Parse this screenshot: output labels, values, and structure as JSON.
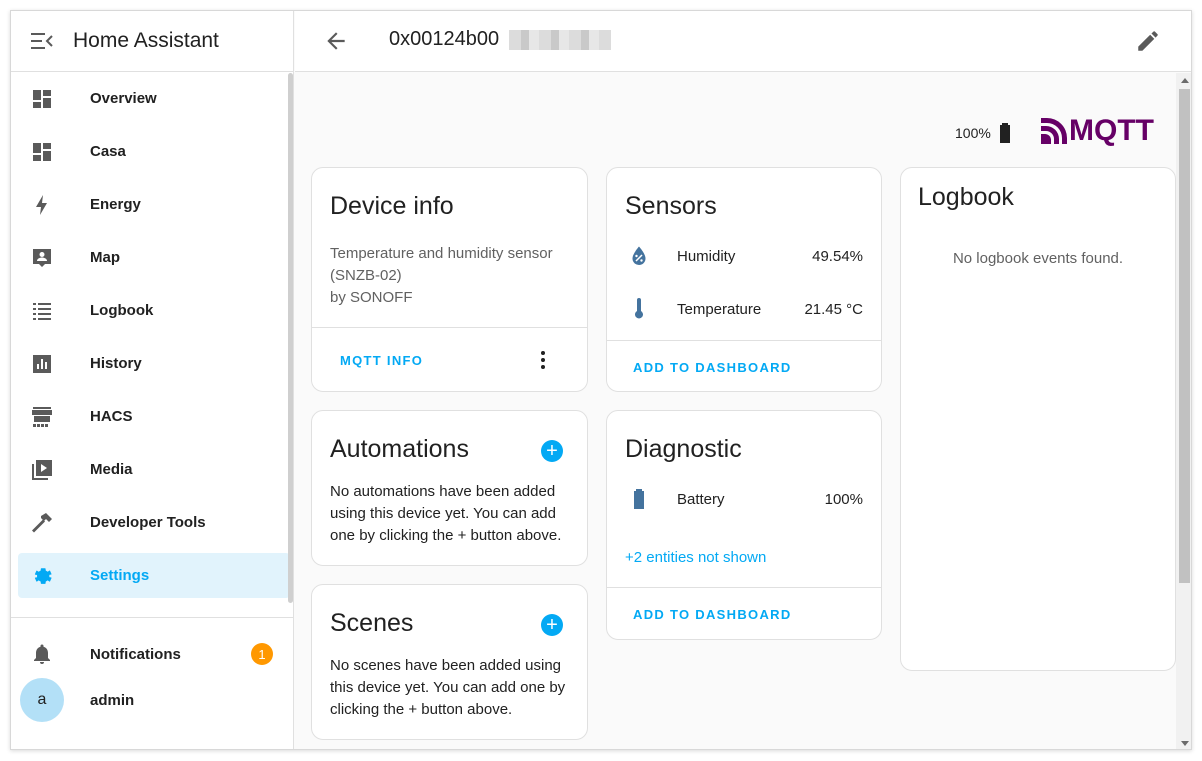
{
  "sidebar": {
    "title": "Home Assistant",
    "items": [
      {
        "label": "Overview",
        "icon": "overview-icon"
      },
      {
        "label": "Casa",
        "icon": "dashboard-icon"
      },
      {
        "label": "Energy",
        "icon": "lightning-icon"
      },
      {
        "label": "Map",
        "icon": "map-icon"
      },
      {
        "label": "Logbook",
        "icon": "logbook-icon"
      },
      {
        "label": "History",
        "icon": "history-chart-icon"
      },
      {
        "label": "HACS",
        "icon": "hacs-store-icon"
      },
      {
        "label": "Media",
        "icon": "media-icon"
      },
      {
        "label": "Developer Tools",
        "icon": "hammer-icon"
      },
      {
        "label": "Settings",
        "icon": "gear-icon"
      }
    ],
    "notifications": {
      "label": "Notifications",
      "count": "1"
    },
    "user": {
      "label": "admin",
      "initial": "a"
    }
  },
  "topbar": {
    "title": "0x00124b00"
  },
  "header_info": {
    "battery": "100%",
    "integration": "MQTT"
  },
  "device_info": {
    "title": "Device info",
    "model": "Temperature and humidity sensor",
    "model_id": "(SNZB-02)",
    "manufacturer": "by SONOFF",
    "action": "MQTT INFO"
  },
  "automations": {
    "title": "Automations",
    "text": "No automations have been added using this device yet. You can add one by clicking the + button above."
  },
  "scenes": {
    "title": "Scenes",
    "text": "No scenes have been added using this device yet. You can add one by clicking the + button above."
  },
  "sensors": {
    "title": "Sensors",
    "entities": [
      {
        "name": "Humidity",
        "value": "49.54%",
        "icon": "water-percent-icon"
      },
      {
        "name": "Temperature",
        "value": "21.45 °C",
        "icon": "thermometer-icon"
      }
    ],
    "action": "ADD TO DASHBOARD"
  },
  "diagnostic": {
    "title": "Diagnostic",
    "entities": [
      {
        "name": "Battery",
        "value": "100%",
        "icon": "battery-icon"
      }
    ],
    "hidden": "+2 entities not shown",
    "action": "ADD TO DASHBOARD"
  },
  "logbook": {
    "title": "Logbook",
    "empty": "No logbook events found."
  },
  "colors": {
    "accent": "#03a9f4",
    "badge": "#ff9800",
    "mqtt": "#660066",
    "entity_icon": "#44739e"
  }
}
